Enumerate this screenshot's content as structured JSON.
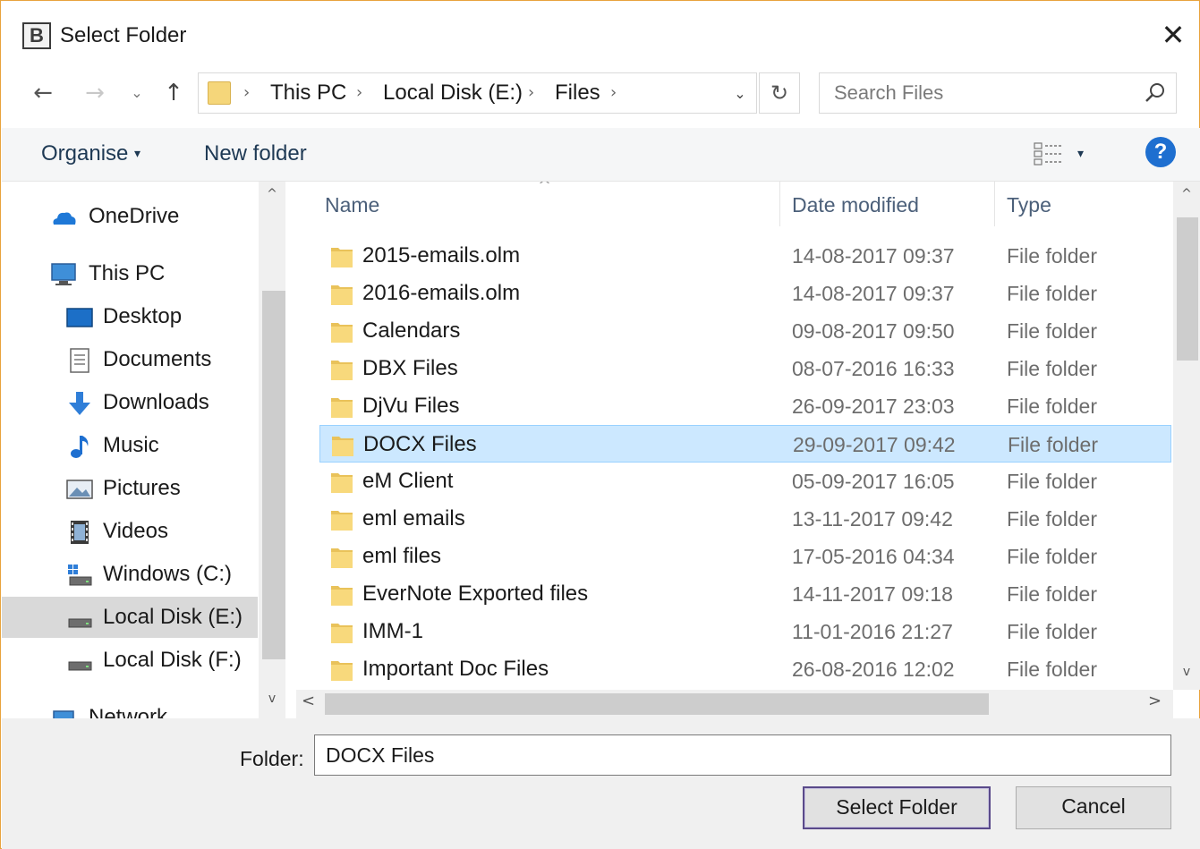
{
  "window": {
    "title": "Select Folder",
    "app_icon_letter": "B",
    "close_glyph": "✕"
  },
  "nav": {
    "back_glyph": "←",
    "forward_glyph": "→",
    "recent_glyph": "⌄",
    "up_glyph": "↑",
    "breadcrumbs": [
      "This PC",
      "Local Disk (E:)",
      "Files"
    ],
    "separator": "›",
    "dropdown_glyph": "⌄",
    "refresh_glyph": "↻"
  },
  "search": {
    "placeholder": "Search Files"
  },
  "toolbar": {
    "organise_label": "Organise",
    "caret": "▾",
    "new_folder_label": "New folder",
    "help_label": "?"
  },
  "sidebar": {
    "items": [
      {
        "label": "OneDrive",
        "icon": "cloud-icon"
      },
      {
        "label": "This PC",
        "icon": "computer-icon"
      },
      {
        "label": "Desktop",
        "icon": "desktop-icon"
      },
      {
        "label": "Documents",
        "icon": "documents-icon"
      },
      {
        "label": "Downloads",
        "icon": "downloads-icon"
      },
      {
        "label": "Music",
        "icon": "music-icon"
      },
      {
        "label": "Pictures",
        "icon": "pictures-icon"
      },
      {
        "label": "Videos",
        "icon": "videos-icon"
      },
      {
        "label": "Windows (C:)",
        "icon": "windows-drive-icon"
      },
      {
        "label": "Local Disk (E:)",
        "icon": "drive-icon",
        "selected": true
      },
      {
        "label": "Local Disk (F:)",
        "icon": "drive-icon"
      },
      {
        "label": "Network",
        "icon": "network-icon"
      }
    ]
  },
  "file_list": {
    "columns": {
      "name": "Name",
      "date": "Date modified",
      "type": "Type"
    },
    "sort_glyph": "^",
    "rows": [
      {
        "name": "2015-emails.olm",
        "date": "14-08-2017 09:37",
        "type": "File folder"
      },
      {
        "name": "2016-emails.olm",
        "date": "14-08-2017 09:37",
        "type": "File folder"
      },
      {
        "name": "Calendars",
        "date": "09-08-2017 09:50",
        "type": "File folder"
      },
      {
        "name": "DBX Files",
        "date": "08-07-2016 16:33",
        "type": "File folder"
      },
      {
        "name": "DjVu Files",
        "date": "26-09-2017 23:03",
        "type": "File folder"
      },
      {
        "name": "DOCX Files",
        "date": "29-09-2017 09:42",
        "type": "File folder",
        "selected": true
      },
      {
        "name": "eM Client",
        "date": "05-09-2017 16:05",
        "type": "File folder"
      },
      {
        "name": "eml emails",
        "date": "13-11-2017 09:42",
        "type": "File folder"
      },
      {
        "name": "eml files",
        "date": "17-05-2016 04:34",
        "type": "File folder"
      },
      {
        "name": "EverNote Exported files",
        "date": "14-11-2017 09:18",
        "type": "File folder"
      },
      {
        "name": "IMM-1",
        "date": "11-01-2016 21:27",
        "type": "File folder"
      },
      {
        "name": "Important Doc Files",
        "date": "26-08-2016 12:02",
        "type": "File folder"
      }
    ]
  },
  "scroll": {
    "up": "^",
    "down": "v",
    "left": "<",
    "right": ">"
  },
  "footer": {
    "folder_label": "Folder:",
    "folder_value": "DOCX Files",
    "select_label": "Select Folder",
    "cancel_label": "Cancel"
  },
  "colors": {
    "accent": "#1e6fd0",
    "selection": "#cce8ff",
    "folder": "#f5d67a",
    "frame": "#e8a33d"
  }
}
